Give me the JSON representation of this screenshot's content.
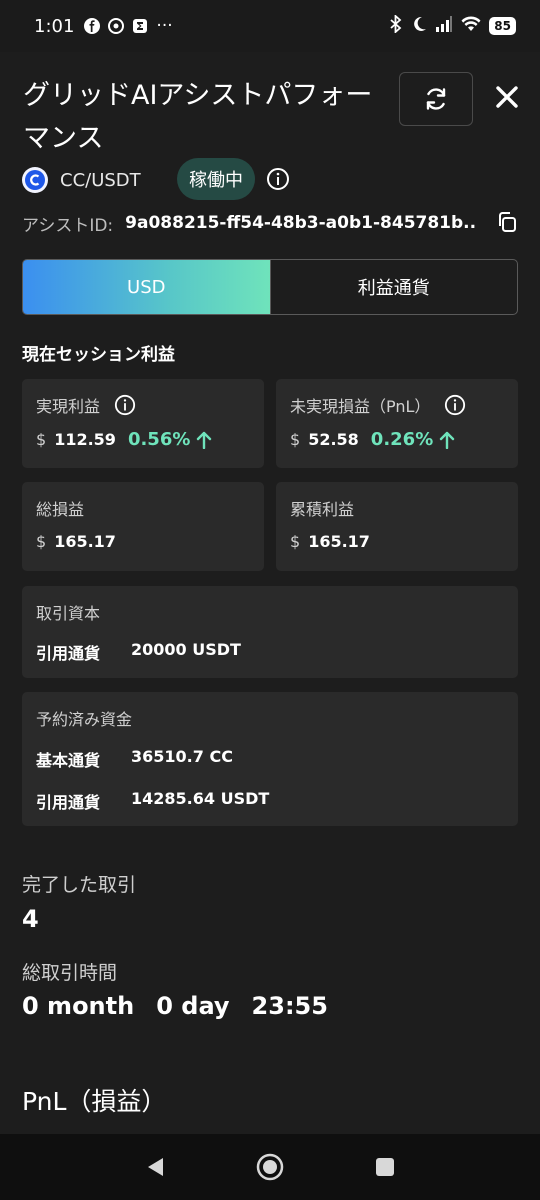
{
  "status_bar": {
    "time": "1:01",
    "more": "···",
    "battery": "85"
  },
  "header": {
    "title": "グリッドAIアシストパフォーマンス",
    "pair": "CC/USDT",
    "status": "稼働中",
    "assist_label": "アシストID:",
    "assist_id": "9a088215-ff54-48b3-a0b1-845781b..."
  },
  "toggle": {
    "options": [
      "USD",
      "利益通貨"
    ],
    "selected": "USD"
  },
  "session": {
    "title": "現在セッション利益",
    "currency_symbol": "$",
    "realized": {
      "label": "実現利益",
      "amount": "112.59",
      "pct": "0.56%"
    },
    "unrealized": {
      "label": "未実現損益（PnL）",
      "amount": "52.58",
      "pct": "0.26%"
    },
    "total": {
      "label": "総損益",
      "amount": "165.17"
    },
    "cumulative": {
      "label": "累積利益",
      "amount": "165.17"
    }
  },
  "capital": {
    "title": "取引資本",
    "quote_label": "引用通貨",
    "quote_value": "20000 USDT"
  },
  "reserved": {
    "title": "予約済み資金",
    "base_label": "基本通貨",
    "base_value": "36510.7 CC",
    "quote_label": "引用通貨",
    "quote_value": "14285.64 USDT"
  },
  "stats": {
    "completed_label": "完了した取引",
    "completed_value": "4",
    "duration_label": "総取引時間",
    "months": "0 month",
    "days": "0 day",
    "clock": "23:55"
  },
  "pnl_section_title": "PnL（損益）",
  "colors": {
    "accent_green": "#6fe3bb",
    "accent_blue": "#3b8ff0",
    "badge_bg": "#254a44",
    "card_bg": "#2a2a2a"
  }
}
